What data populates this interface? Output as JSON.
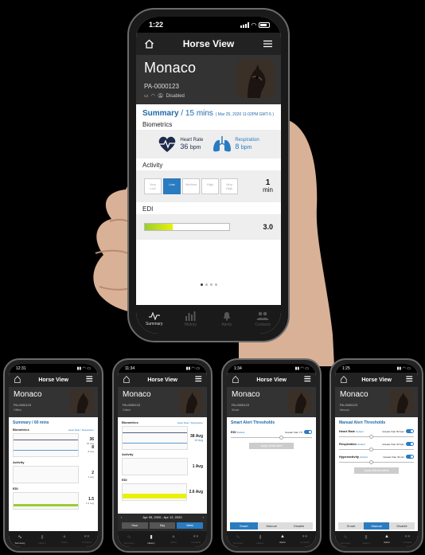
{
  "main": {
    "status": {
      "time": "1:22"
    },
    "header": {
      "title": "Horse View"
    },
    "profile": {
      "name": "Monaco",
      "id": "PA-0000123",
      "status_text": "Disabled"
    },
    "summary": {
      "label": "Summary",
      "duration": "/ 15 mins",
      "range": "( Mar 25, 2020 11:02PM GMT-5 )"
    },
    "biometrics": {
      "label": "Biometrics",
      "heart_rate": {
        "label": "Heart Rate",
        "value": "36",
        "unit": "bpm"
      },
      "respiration": {
        "label": "Respiration",
        "value": "8",
        "unit": "bpm"
      }
    },
    "activity": {
      "label": "Activity",
      "levels": [
        "Very Low",
        "Low",
        "Medium",
        "High",
        "Very High"
      ],
      "active_level": "Low",
      "value": "1",
      "unit": "min"
    },
    "edi": {
      "label": "EDI",
      "value": "3.0",
      "fill_fraction": 0.33
    },
    "tabs": [
      {
        "label": "Summary",
        "icon": "pulse-icon",
        "active": true
      },
      {
        "label": "History",
        "icon": "bar-chart-icon",
        "active": false
      },
      {
        "label": "Alerts",
        "icon": "bell-icon",
        "active": false
      },
      {
        "label": "Contacts",
        "icon": "people-icon",
        "active": false
      }
    ]
  },
  "small": {
    "p1": {
      "time": "12:31",
      "title": "Horse View",
      "name": "Monaco",
      "id": "PA-0000123",
      "status": "Offline",
      "summary": "Summary / 60 mins",
      "bio_label": "Biometrics",
      "bio_legend": "Heart Rate / Respiration",
      "hr": "36",
      "hr_unit": "36 Avg",
      "resp": "8",
      "resp_unit": "8 Avg",
      "activity_label": "Activity",
      "activity": "2",
      "activity_unit": "1 Avg",
      "edi_label": "EDI",
      "edi": "1.5",
      "edi_unit": "1.5 Avg"
    },
    "p2": {
      "time": "11:34",
      "title": "Horse View",
      "name": "Monaco",
      "id": "PA-0000123",
      "status": "Online",
      "bio_label": "Biometrics",
      "bio_legend": "Heart Rate / Respiration",
      "hr": "38 Avg",
      "resp": "10 Avg",
      "activity_label": "Activity",
      "activity": "1 Avg",
      "edi_label": "EDI",
      "edi": "2.6 Avg",
      "date_range": "Apr 05, 2020 - Apr 12, 2020",
      "ranges": [
        "Hour",
        "Day",
        "Week"
      ],
      "active_range": "Week"
    },
    "p3": {
      "time": "1:34",
      "title": "Horse View",
      "name": "Monaco",
      "id": "PA-0000123",
      "status": "Smart",
      "heading": "Smart Alert Thresholds",
      "edi_label": "EDI",
      "edi_default": "Default",
      "edi_threshold": "Greater than 7.5",
      "apply": "Apply Smart Alert",
      "modes": [
        "Smart",
        "Manual",
        "Disable"
      ],
      "active_mode": "Smart"
    },
    "p4": {
      "time": "1:25",
      "title": "Horse View",
      "name": "Monaco",
      "id": "PA-0000123",
      "status": "Manual",
      "heading": "Manual Alert Thresholds",
      "rows": [
        {
          "label": "Heart Rate",
          "default": "Default",
          "threshold": "Greater than 50 bpm"
        },
        {
          "label": "Respiration",
          "default": "Default",
          "threshold": "Greater than 20 bpm"
        },
        {
          "label": "Hyperactivity",
          "default": "Default",
          "threshold": "Greater than 40 min"
        }
      ],
      "apply": "Apply Manual Alerts",
      "modes": [
        "Smart",
        "Manual",
        "Disable"
      ],
      "active_mode": "Manual"
    }
  },
  "colors": {
    "accent": "#2a7bc0",
    "navy": "#1f2b4d",
    "dark": "#333333",
    "edi_start": "#9acd32",
    "edi_end": "#e8f10a"
  }
}
